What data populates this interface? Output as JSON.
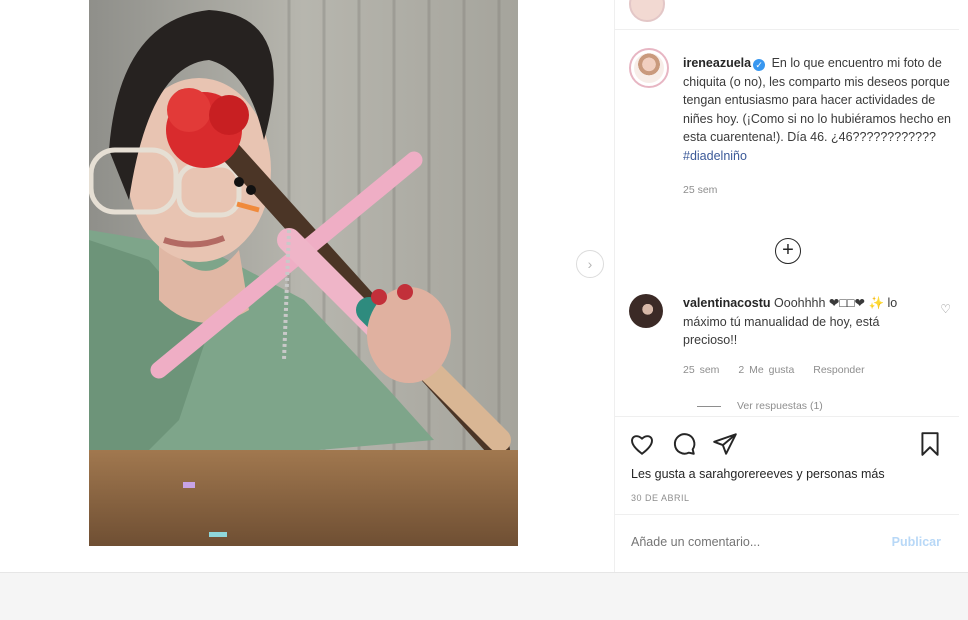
{
  "post": {
    "author": "ireneazuela",
    "caption": "En lo que encuentro mi foto de chiquita (o no), les comparto mis deseos porque tengan entusiasmo para hacer actividades de niñes hoy. (¡Como si no lo hubiéramos hecho en esta cuarentena!). Día 46. ¿46????????????",
    "hashtag": "#diadelniño",
    "time": "25 sem",
    "load_more_symbol": "+"
  },
  "comment": {
    "author": "valentinacostu",
    "text": "Ooohhhh ❤□□❤ ✨ lo máximo tú manualidad de hoy, está precioso!!",
    "time": "25 sem",
    "likes": "2 Me gusta",
    "reply": "Responder",
    "view_replies": "Ver respuestas (1)",
    "heart_symbol": "♡"
  },
  "footer": {
    "likes_text": "Les gusta a sarahgorereeves y personas más",
    "date": "30 DE ABRIL",
    "comment_placeholder": "Añade un comentario...",
    "publish": "Publicar"
  },
  "nav": {
    "next_symbol": "›"
  },
  "colors": {
    "link": "#3b5998",
    "verified": "#3897f0",
    "publish_disabled": "#b8d8f7"
  }
}
